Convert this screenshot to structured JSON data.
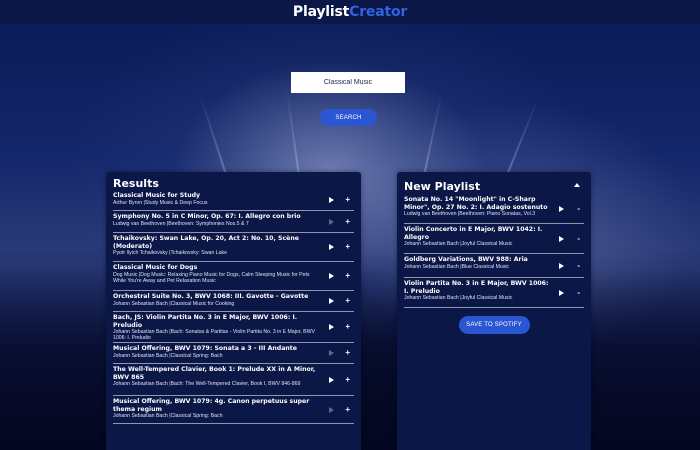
{
  "header": {
    "logo_part1": "Playlist",
    "logo_part2": "Creator"
  },
  "search": {
    "value": "Classical Music",
    "button_label": "SEARCH"
  },
  "results": {
    "title": "Results",
    "items": [
      {
        "title": "Classical Music for Study",
        "meta": "Arthur Byron |Study Music & Deep Focus",
        "action": "+"
      },
      {
        "title": "Symphony No. 5 in C Minor, Op. 67: I. Allegro con brio",
        "meta": "Ludwig van Beethoven |Beethoven: Symphonies Nos.5 & 7",
        "action": "+"
      },
      {
        "title": "Tchaikovsky: Swan Lake, Op. 20, Act 2: No. 10, Scène (Moderato)",
        "meta": "Pyotr Ilyich Tchaikovsky |Tchaikovsky: Swan Lake",
        "action": "+"
      },
      {
        "title": "Classical Music for Dogs",
        "meta": "Dog Music |Dog Music: Relaxing Piano Music for Dogs, Calm Sleeping Music for Pets While You're Away and Pet Relaxation Music",
        "action": "+"
      },
      {
        "title": "Orchestral Suite No. 3, BWV 1068: III. Gavotte - Gavotte",
        "meta": "Johann Sebastian Bach |Classical Music for Cooking",
        "action": "+"
      },
      {
        "title": "Bach, JS: Violin Partita No. 3 in E Major, BWV 1006: I. Preludio",
        "meta": "Johann Sebastian Bach |Bach: Sonatas & Partitas - Violin Partita No. 3 in E Major, BWV 1006: I. Preludio",
        "action": "+"
      },
      {
        "title": "Musical Offering, BWV 1079: Sonata a 3 - III Andante",
        "meta": "Johann Sebastian Bach |Classical Spring: Bach",
        "action": "+"
      },
      {
        "title": "The Well-Tempered Clavier, Book 1: Prelude XX in A Minor, BWV 865",
        "meta": "Johann Sebastian Bach |Bach: The Well-Tempered Clavier, Book I, BWV 846-869",
        "action": "+"
      },
      {
        "title": "Musical Offering, BWV 1079: 4g. Canon perpetuus super thema regium",
        "meta": "Johann Sebastian Bach |Classical Spring: Bach",
        "action": "+"
      }
    ]
  },
  "playlist": {
    "title": "New Playlist",
    "items": [
      {
        "title": "Sonata No. 14 \"Moonlight\" in C-Sharp Minor\", Op. 27 No. 2: I. Adagio sostenuto",
        "meta": "Ludwig van Beethoven |Beethoven: Piano Sonatas, Vol.3",
        "action": "-"
      },
      {
        "title": "Violin Concerto in E Major, BWV 1042: I. Allegro",
        "meta": "Johann Sebastian Bach |Joyful Classical Music",
        "action": "-"
      },
      {
        "title": "Goldberg Variations, BWV 988: Aria",
        "meta": "Johann Sebastian Bach |Blue Classical Music",
        "action": "-"
      },
      {
        "title": "Violin Partita No. 3 in E Major, BWV 1006: I. Preludio",
        "meta": "Johann Sebastian Bach |Joyful Classical Music",
        "action": "-"
      }
    ],
    "save_label": "SAVE TO SPOTIFY"
  },
  "colors": {
    "brand_blue": "#2f63e0",
    "button_blue": "#2a56d4",
    "panel_bg": "#0a1747"
  },
  "icons": {
    "play": "play-icon",
    "add": "plus-icon",
    "remove": "minus-icon",
    "collapse": "chevron-up-icon"
  }
}
